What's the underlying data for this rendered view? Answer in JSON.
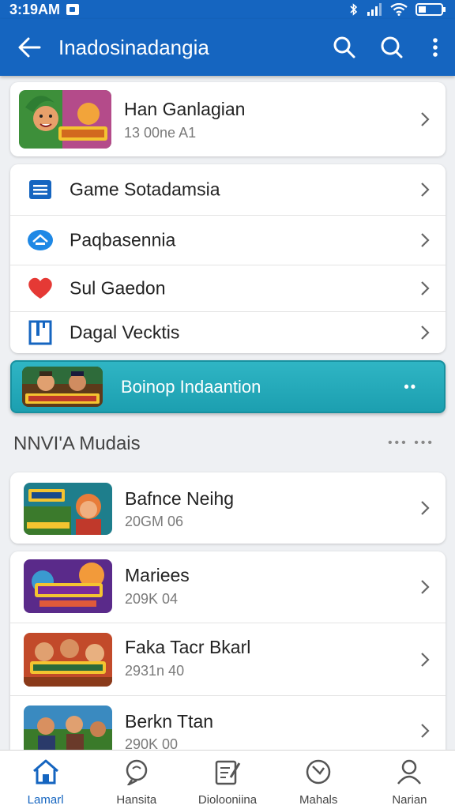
{
  "status_bar": {
    "time": "3:19AM"
  },
  "app_bar": {
    "title": "Inadosinadangia"
  },
  "profile_card": {
    "title": "Han Ganlagian",
    "subtitle": "13 00ne A1"
  },
  "menu": [
    {
      "label": "Game Sotadamsia",
      "icon": "list-icon"
    },
    {
      "label": "Paqbasennia",
      "icon": "house-icon"
    },
    {
      "label": "Sul Gaedon",
      "icon": "heart-icon"
    },
    {
      "label": "Dagal Vecktis",
      "icon": "bookmark-icon"
    }
  ],
  "banner": {
    "label": "Boinop Indaantion",
    "more": "••"
  },
  "section": {
    "title": "NNVI'A Mudais",
    "more": "••• •••"
  },
  "games": [
    {
      "title": "Bafnce Neihg",
      "subtitle": "20GM 06"
    },
    {
      "title": "Mariees",
      "subtitle": "209K 04"
    },
    {
      "title": "Faka Tacr Bkarl",
      "subtitle": "2931n 40"
    },
    {
      "title": "Berkn Ttan",
      "subtitle": "290K 00"
    }
  ],
  "bottom_nav": [
    {
      "label": "Lamarl",
      "active": true
    },
    {
      "label": "Hansita",
      "active": false
    },
    {
      "label": "Diolooniina",
      "active": false
    },
    {
      "label": "Mahals",
      "active": false
    },
    {
      "label": "Narian",
      "active": false
    }
  ],
  "colors": {
    "primary": "#1565c0",
    "banner": "#23a9b9",
    "heart": "#e53935"
  }
}
